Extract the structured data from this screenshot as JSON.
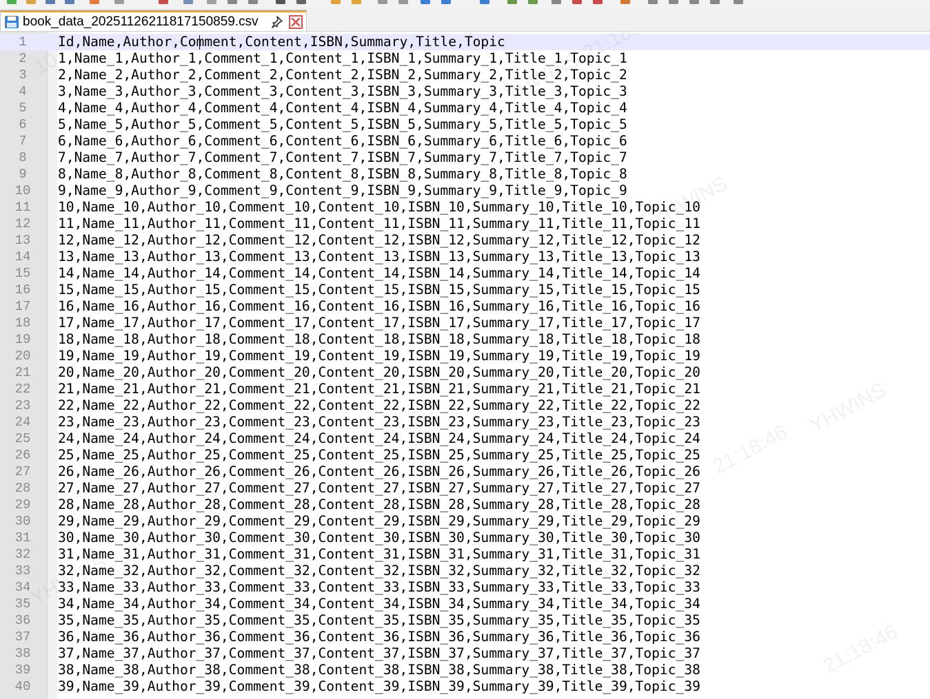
{
  "tab": {
    "title": "book_data_20251126211817150859.csv"
  },
  "icons": {
    "file": "save-disk-icon",
    "pin": "pin-icon",
    "close": "close-x-icon"
  },
  "colors": {
    "tab_accent": "#f7a41c",
    "current_line": "#e8e8ff",
    "close_button": "#d9534f"
  },
  "editor": {
    "lines": [
      {
        "n": "1",
        "text": "Id,Name,Author,Comment,Content,ISBN,Summary,Title,Topic"
      },
      {
        "n": "2",
        "text": "1,Name_1,Author_1,Comment_1,Content_1,ISBN_1,Summary_1,Title_1,Topic_1"
      },
      {
        "n": "3",
        "text": "2,Name_2,Author_2,Comment_2,Content_2,ISBN_2,Summary_2,Title_2,Topic_2"
      },
      {
        "n": "4",
        "text": "3,Name_3,Author_3,Comment_3,Content_3,ISBN_3,Summary_3,Title_3,Topic_3"
      },
      {
        "n": "5",
        "text": "4,Name_4,Author_4,Comment_4,Content_4,ISBN_4,Summary_4,Title_4,Topic_4"
      },
      {
        "n": "6",
        "text": "5,Name_5,Author_5,Comment_5,Content_5,ISBN_5,Summary_5,Title_5,Topic_5"
      },
      {
        "n": "7",
        "text": "6,Name_6,Author_6,Comment_6,Content_6,ISBN_6,Summary_6,Title_6,Topic_6"
      },
      {
        "n": "8",
        "text": "7,Name_7,Author_7,Comment_7,Content_7,ISBN_7,Summary_7,Title_7,Topic_7"
      },
      {
        "n": "9",
        "text": "8,Name_8,Author_8,Comment_8,Content_8,ISBN_8,Summary_8,Title_8,Topic_8"
      },
      {
        "n": "10",
        "text": "9,Name_9,Author_9,Comment_9,Content_9,ISBN_9,Summary_9,Title_9,Topic_9"
      },
      {
        "n": "11",
        "text": "10,Name_10,Author_10,Comment_10,Content_10,ISBN_10,Summary_10,Title_10,Topic_10"
      },
      {
        "n": "12",
        "text": "11,Name_11,Author_11,Comment_11,Content_11,ISBN_11,Summary_11,Title_11,Topic_11"
      },
      {
        "n": "13",
        "text": "12,Name_12,Author_12,Comment_12,Content_12,ISBN_12,Summary_12,Title_12,Topic_12"
      },
      {
        "n": "14",
        "text": "13,Name_13,Author_13,Comment_13,Content_13,ISBN_13,Summary_13,Title_13,Topic_13"
      },
      {
        "n": "15",
        "text": "14,Name_14,Author_14,Comment_14,Content_14,ISBN_14,Summary_14,Title_14,Topic_14"
      },
      {
        "n": "16",
        "text": "15,Name_15,Author_15,Comment_15,Content_15,ISBN_15,Summary_15,Title_15,Topic_15"
      },
      {
        "n": "17",
        "text": "16,Name_16,Author_16,Comment_16,Content_16,ISBN_16,Summary_16,Title_16,Topic_16"
      },
      {
        "n": "18",
        "text": "17,Name_17,Author_17,Comment_17,Content_17,ISBN_17,Summary_17,Title_17,Topic_17"
      },
      {
        "n": "19",
        "text": "18,Name_18,Author_18,Comment_18,Content_18,ISBN_18,Summary_18,Title_18,Topic_18"
      },
      {
        "n": "20",
        "text": "19,Name_19,Author_19,Comment_19,Content_19,ISBN_19,Summary_19,Title_19,Topic_19"
      },
      {
        "n": "21",
        "text": "20,Name_20,Author_20,Comment_20,Content_20,ISBN_20,Summary_20,Title_20,Topic_20"
      },
      {
        "n": "22",
        "text": "21,Name_21,Author_21,Comment_21,Content_21,ISBN_21,Summary_21,Title_21,Topic_21"
      },
      {
        "n": "23",
        "text": "22,Name_22,Author_22,Comment_22,Content_22,ISBN_22,Summary_22,Title_22,Topic_22"
      },
      {
        "n": "24",
        "text": "23,Name_23,Author_23,Comment_23,Content_23,ISBN_23,Summary_23,Title_23,Topic_23"
      },
      {
        "n": "25",
        "text": "24,Name_24,Author_24,Comment_24,Content_24,ISBN_24,Summary_24,Title_24,Topic_24"
      },
      {
        "n": "26",
        "text": "25,Name_25,Author_25,Comment_25,Content_25,ISBN_25,Summary_25,Title_25,Topic_25"
      },
      {
        "n": "27",
        "text": "26,Name_26,Author_26,Comment_26,Content_26,ISBN_26,Summary_26,Title_26,Topic_26"
      },
      {
        "n": "28",
        "text": "27,Name_27,Author_27,Comment_27,Content_27,ISBN_27,Summary_27,Title_27,Topic_27"
      },
      {
        "n": "29",
        "text": "28,Name_28,Author_28,Comment_28,Content_28,ISBN_28,Summary_28,Title_28,Topic_28"
      },
      {
        "n": "30",
        "text": "29,Name_29,Author_29,Comment_29,Content_29,ISBN_29,Summary_29,Title_29,Topic_29"
      },
      {
        "n": "31",
        "text": "30,Name_30,Author_30,Comment_30,Content_30,ISBN_30,Summary_30,Title_30,Topic_30"
      },
      {
        "n": "32",
        "text": "31,Name_31,Author_31,Comment_31,Content_31,ISBN_31,Summary_31,Title_31,Topic_31"
      },
      {
        "n": "33",
        "text": "32,Name_32,Author_32,Comment_32,Content_32,ISBN_32,Summary_32,Title_32,Topic_32"
      },
      {
        "n": "34",
        "text": "33,Name_33,Author_33,Comment_33,Content_33,ISBN_33,Summary_33,Title_33,Topic_33"
      },
      {
        "n": "35",
        "text": "34,Name_34,Author_34,Comment_34,Content_34,ISBN_34,Summary_34,Title_34,Topic_34"
      },
      {
        "n": "36",
        "text": "35,Name_35,Author_35,Comment_35,Content_35,ISBN_35,Summary_35,Title_35,Topic_35"
      },
      {
        "n": "37",
        "text": "36,Name_36,Author_36,Comment_36,Content_36,ISBN_36,Summary_36,Title_36,Topic_36"
      },
      {
        "n": "38",
        "text": "37,Name_37,Author_37,Comment_37,Content_37,ISBN_37,Summary_37,Title_37,Topic_37"
      },
      {
        "n": "39",
        "text": "38,Name_38,Author_38,Comment_38,Content_38,ISBN_38,Summary_38,Title_38,Topic_38"
      },
      {
        "n": "40",
        "text": "39,Name_39,Author_39,Comment_39,Content_39,ISBN_39,Summary_39,Title_39,Topic_39"
      }
    ]
  }
}
